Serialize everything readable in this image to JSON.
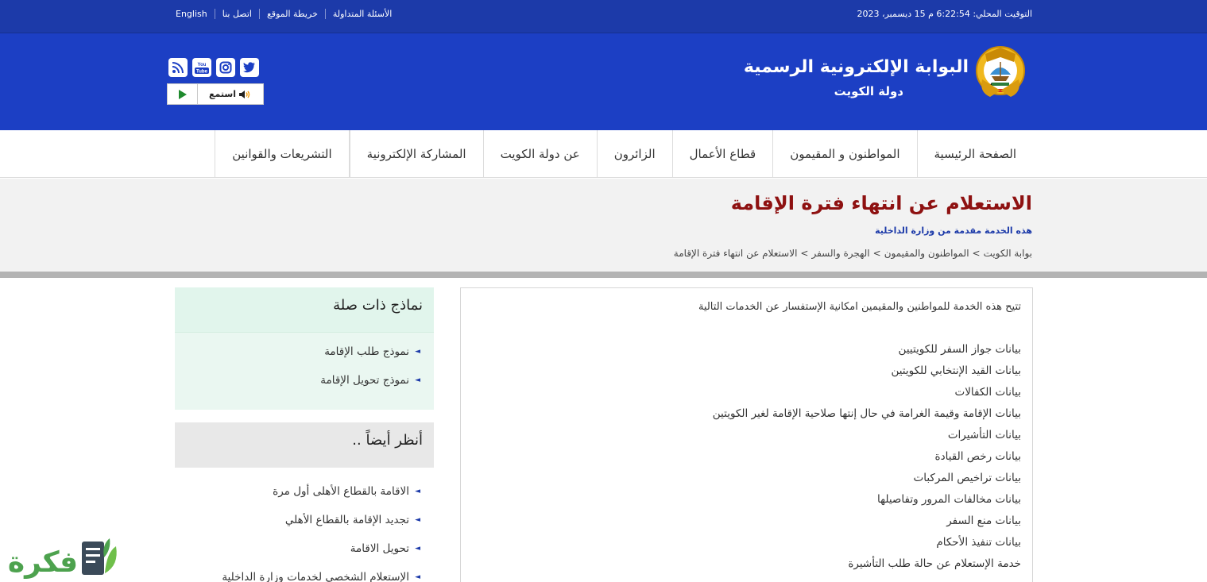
{
  "topbar": {
    "clock": "التوقيت المحلي: 6:22:54 م 15 ديسمبر، 2023",
    "links": [
      "English",
      "اتصل بنا",
      "خريطة الموقع",
      "الأسئلة المتداولة"
    ]
  },
  "header": {
    "title": "البوابة الإلكترونية الرسمية",
    "subtitle": "دولة الكويت",
    "social_icons": [
      "rss-icon",
      "youtube-icon",
      "instagram-icon",
      "twitter-icon"
    ],
    "youtube_text": "You Tube",
    "listen_label": "استمع"
  },
  "nav": {
    "items": [
      "الصفحة الرئيسية",
      "المواطنون و المقيمون",
      "قطاع الأعمال",
      "الزائرون",
      "عن دولة الكويت",
      "المشاركة الإلكترونية",
      "التشريعات والقوانين"
    ]
  },
  "page": {
    "title": "الاستعلام عن انتهاء فترة الإقامة",
    "provider": "هذه الخدمة مقدمة من وزارة الداخلية",
    "breadcrumb": [
      "بوابة الكويت",
      ">",
      "المواطنون والمقيمون",
      ">",
      "الهجرة والسفر",
      ">",
      "الاستعلام عن انتهاء فترة الإقامة"
    ]
  },
  "content": {
    "intro": "تتيح هذه الخدمة للمواطنين والمقيمين امكانية الإستفسار عن الخدمات التالية",
    "services": [
      "بيانات جواز السفر للكويتيين",
      "بيانات القيد الإنتخابي للكويتين",
      "بيانات الكفالات",
      "بيانات الإقامة وقيمة الغرامة في حال إنتها صلاحية الإقامة لغير الكويتين",
      "بيانات التأشيرات",
      "بيانات رخص القيادة",
      "بيانات تراخيص المركبات",
      "بيانات مخالفات المرور وتفاصيلها",
      "بيانات منع السفر",
      "بيانات تنفيذ الأحكام",
      "خدمة الإستعلام عن حالة طلب التأشيرة"
    ]
  },
  "sidebar": {
    "forms_title": "نماذج ذات صلة",
    "forms": [
      "نموذج طلب الإقامة",
      "نموذج تحويل الإقامة"
    ],
    "see_also_title": "أنظر أيضاً ..",
    "see_also": [
      "الاقامة بالقطاع الأهلى أول مرة",
      "تجديد الإقامة بالقطاع الأهلي",
      "تحويل الاقامة",
      "الإستعلام الشخصي لخدمات وزارة الداخلية"
    ]
  },
  "watermark": {
    "text": "فكرة"
  },
  "colors": {
    "top_bar": "#1c3aa9",
    "header": "#1c3fc4",
    "title_red": "#8e1111",
    "mint": "#e1f5ec",
    "watermark_green": "#4da24e"
  }
}
